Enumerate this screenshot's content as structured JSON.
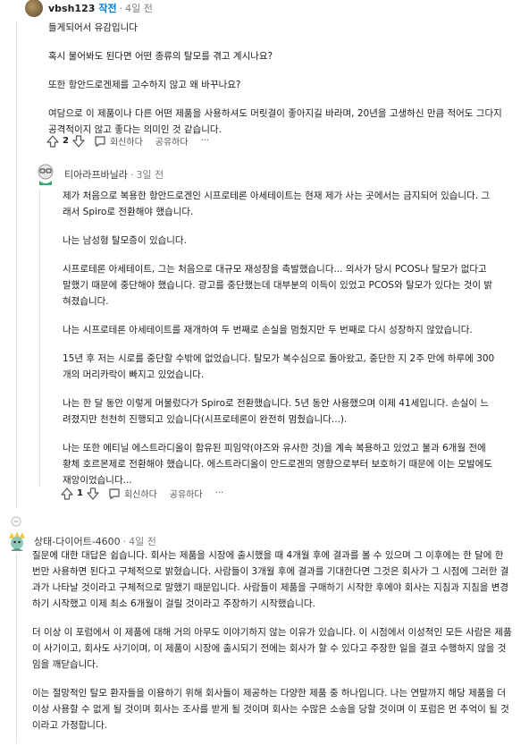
{
  "comments": [
    {
      "author": "vbsh123",
      "op_badge": "작전",
      "sep": "·",
      "time": "4일 전",
      "paragraphs": [
        "들게되어서 유감입니다",
        "혹시 물어봐도 된다면 어떤 종류의 탈모를 겪고 계시나요?",
        "또한 항안드로겐제를 고수하지 않고 왜 바꾸나요?",
        "여담으로 이 제품이나 다른 어떤 제품을 사용하셔도 머릿결이 좋아지길 바라며, 20년을 고생하신 만큼 적어도 그다지 공격적이지 않고 좋다는 의미인 것 같습니다."
      ],
      "votes": "2",
      "reply_label": "회신하다",
      "share_label": "공유하다",
      "more_label": "···"
    },
    {
      "author": "티아라프바닐라",
      "sep": "·",
      "time": "3일 전",
      "paragraphs": [
        "제가 처음으로 복용한 항안드로겐인 시프로테론 아세테이트는 현재 제가 사는 곳에서는 금지되어 있습니다. 그래서 Spiro로 전환해야 했습니다.",
        "나는 남성형 탈모증이 있습니다.",
        "시프로테론 아세테이트, 그는 처음으로 대규모 재성장을 촉발했습니다... 의사가 당시 PCOS나 탈모가 없다고 말했기 때문에 중단해야 했습니다. 광고를 중단했는데 대부분의 이득이 있었고 PCOS와 탈모가 있다는 것이 밝혀졌습니다.",
        "나는 시프로테론 아세테이트를 재개하여 두 번째로 손실을 멈췄지만 두 번째로 다시 성장하지 않았습니다.",
        "15년 후 저는 시로를 중단할 수밖에 없었습니다. 탈모가 복수심으로 돌아왔고, 중단한 지 2주 만에 하루에 300개의 머리카락이 빠지고 있었습니다.",
        "나는 한 달 동안 이렇게 머물렀다가 Spiro로 전환했습니다. 5년 동안 사용했으며 이제 41세입니다. 손실이 느려졌지만 천천히 진행되고 있습니다(시프로테론이 완전히 멈췄습니다...).",
        "나는 또한 에티닐 에스트라디올이 함유된 피임약(야즈와 유사한 것)을 계속 복용하고 있었고 불과 6개월 전에 황체 호르몬제로 전환해야 했습니다. 에스트라디올이 안드로겐의 영향으로부터 보호하기 때문에 이는 모발에도 재앙이었습니다..."
      ],
      "votes": "1",
      "reply_label": "회신하다",
      "share_label": "공유하다",
      "more_label": "···"
    },
    {
      "author": "상태-다이어트-4600",
      "sep": "·",
      "time": "4일 전",
      "paragraphs": [
        "질문에 대한 대답은 쉽습니다. 회사는 제품을 시장에 출시했을 때 4개월 후에 결과를 볼 수 있으며 그 이후에는 한 달에 한 번만 사용하면 된다고 구체적으로 밝혔습니다. 사람들이 3개월 후에 결과를 기대한다면 그것은 회사가 그 시점에 그러한 결과가 나타날 것이라고 구체적으로 말했기 때문입니다. 사람들이 제품을 구매하기 시작한 후에야 회사는 지침과 지침을 변경하기 시작했고 이제 최소 6개월이 걸릴 것이라고 주장하기 시작했습니다.",
        "더 이상 이 포럼에서 이 제품에 대해 거의 아무도 이야기하지 않는 이유가 있습니다. 이 시점에서 이성적인 모든 사람은 제품이 사기이고, 회사도 사기이며, 이 제품이 시장에 출시되기 전에는 회사가 할 수 있다고 주장한 일을 결코 수행하지 않을 것임을 깨닫습니다.",
        "이는 절망적인 탈모 환자들을 이용하기 위해 회사들이 제공하는 다양한 제품 중 하나입니다. 나는 연말까지 해당 제품을 더 이상 사용할 수 없게 될 것이며 회사는 조사를 받게 될 것이며 회사는 수많은 소송을 당할 것이며 이 포럼은 먼 추억이 될 것이라고 가정합니다."
      ]
    }
  ],
  "colors": {
    "op_badge": "#0079d3",
    "meta": "#7c7c7c",
    "text": "#1c1c1c",
    "thread_line": "#e0e0e0",
    "avatar1": "#6b5a3a",
    "avatar3": "#7fb7a8"
  },
  "icons": [
    "upvote-icon",
    "downvote-icon",
    "comment-bubble-icon",
    "thread-collapse-icon"
  ]
}
